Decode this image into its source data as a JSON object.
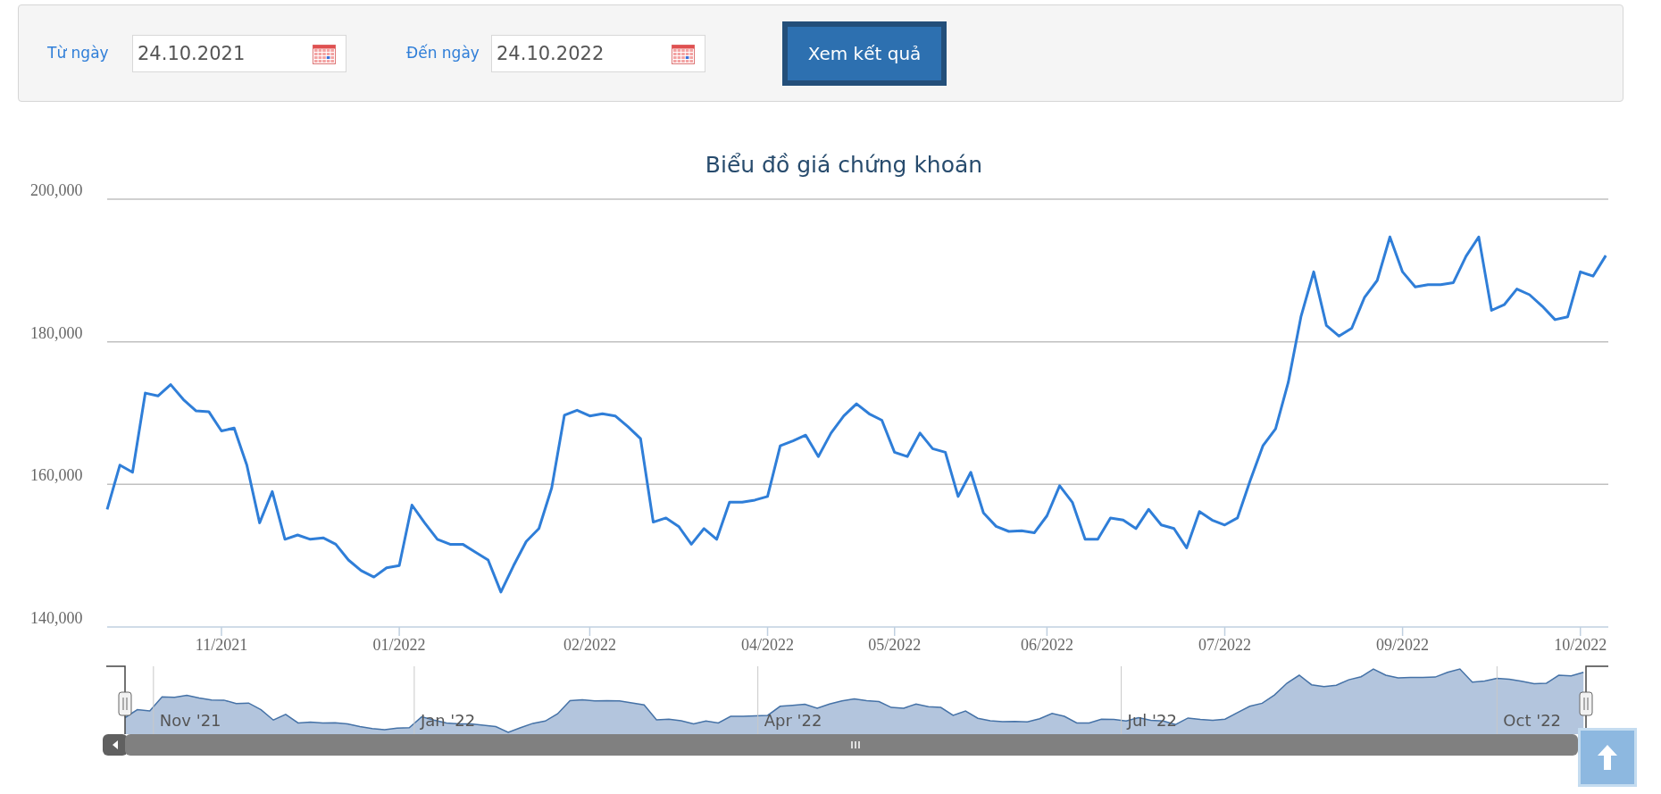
{
  "filter": {
    "from": {
      "label": "Từ ngày",
      "value": "24.10.2021"
    },
    "to": {
      "label": "Đến ngày",
      "value": "24.10.2022"
    },
    "submit": "Xem kết quả"
  },
  "chart": {
    "chart_data": {
      "type": "line",
      "title": "Biểu đồ giá chứng khoán",
      "ylim": [
        140000,
        200000
      ],
      "yticks": [
        {
          "value": 140000,
          "label": "140,000"
        },
        {
          "value": 160000,
          "label": "160,000"
        },
        {
          "value": 180000,
          "label": "180,000"
        },
        {
          "value": 200000,
          "label": "200,000"
        }
      ],
      "categories": [
        null,
        null,
        null,
        null,
        null,
        null,
        null,
        null,
        null,
        "11/2021",
        null,
        null,
        null,
        null,
        null,
        null,
        null,
        null,
        null,
        null,
        null,
        null,
        null,
        "01/2022",
        null,
        null,
        null,
        null,
        null,
        null,
        null,
        null,
        null,
        null,
        null,
        null,
        null,
        null,
        "02/2022",
        null,
        null,
        null,
        null,
        null,
        null,
        null,
        null,
        null,
        null,
        null,
        null,
        null,
        "04/2022",
        null,
        null,
        null,
        null,
        null,
        null,
        null,
        null,
        null,
        "05/2022",
        null,
        null,
        null,
        null,
        null,
        null,
        null,
        null,
        null,
        null,
        null,
        "06/2022",
        null,
        null,
        null,
        null,
        null,
        null,
        null,
        null,
        null,
        null,
        null,
        null,
        null,
        "07/2022",
        null,
        null,
        null,
        null,
        null,
        null,
        null,
        null,
        null,
        null,
        null,
        null,
        null,
        "09/2022",
        null,
        null,
        null,
        null,
        null,
        null,
        null,
        null,
        null,
        null,
        null,
        null,
        null,
        "10/2022",
        null,
        null
      ],
      "values": [
        156500,
        162700,
        161700,
        172800,
        172400,
        174000,
        171900,
        170300,
        170200,
        167500,
        167900,
        162700,
        154600,
        159000,
        152300,
        152900,
        152300,
        152500,
        151600,
        149400,
        147900,
        147000,
        148300,
        148600,
        157100,
        154600,
        152300,
        151600,
        151600,
        150500,
        149400,
        144900,
        148600,
        152000,
        153800,
        159500,
        169700,
        170400,
        169600,
        169900,
        169600,
        168100,
        166400,
        154700,
        155300,
        154100,
        151600,
        153800,
        152300,
        157500,
        157500,
        157800,
        158300,
        165400,
        166100,
        166900,
        163900,
        167200,
        169600,
        171300,
        169900,
        169000,
        164500,
        163900,
        167200,
        165000,
        164500,
        158300,
        161700,
        156000,
        154100,
        153400,
        153500,
        153200,
        155600,
        159800,
        157500,
        152300,
        152300,
        155300,
        155000,
        153800,
        156500,
        154300,
        153800,
        151100,
        156200,
        155000,
        154300,
        155300,
        160500,
        165400,
        167800,
        174300,
        183500,
        189800,
        182300,
        180800,
        181900,
        186200,
        188600,
        194700,
        189800,
        187700,
        188000,
        188000,
        188300,
        192000,
        194700,
        184400,
        185200,
        187400,
        186600,
        185000,
        183100,
        183500,
        189800,
        189200,
        192100
      ]
    }
  },
  "navigator": {
    "labels": [
      "Nov '21",
      "Jan '22",
      "Apr '22",
      "Jul '22",
      "Oct '22"
    ]
  }
}
